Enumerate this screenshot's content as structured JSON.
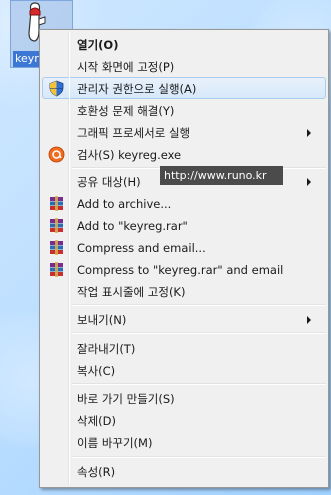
{
  "desktop": {
    "icon_label": "keyre",
    "icon_name": "keyreg-exe-icon"
  },
  "menu": {
    "items": [
      {
        "label": "열기(O)",
        "bold": true
      },
      {
        "label": "시작 화면에 고정(P)"
      },
      {
        "label": "관리자 권한으로 실행(A)",
        "icon": "shield-icon",
        "highlighted": true
      },
      {
        "label": "호환성 문제 해결(Y)"
      },
      {
        "label": "그래픽 프로세서로 실행",
        "submenu": true
      },
      {
        "label": "검사(S) keyreg.exe",
        "icon": "antivirus-icon"
      },
      {
        "label": "공유 대상(H)",
        "submenu": true
      },
      {
        "label": "Add to archive...",
        "icon": "winrar-icon"
      },
      {
        "label": "Add to \"keyreg.rar\"",
        "icon": "winrar-icon"
      },
      {
        "label": "Compress and email...",
        "icon": "winrar-icon"
      },
      {
        "label": "Compress to \"keyreg.rar\" and email",
        "icon": "winrar-icon"
      },
      {
        "label": "작업 표시줄에 고정(K)"
      },
      {
        "label": "보내기(N)",
        "submenu": true
      },
      {
        "label": "잘라내기(T)"
      },
      {
        "label": "복사(C)"
      },
      {
        "label": "바로 가기 만들기(S)"
      },
      {
        "label": "삭제(D)"
      },
      {
        "label": "이름 바꾸기(M)"
      },
      {
        "label": "속성(R)"
      }
    ]
  },
  "tooltip": {
    "text": "http://www.runo.kr"
  },
  "colors": {
    "menu_bg": "#f0f0f0",
    "highlight_border": "#a8cdee",
    "selection_blue": "#3d77d6",
    "tooltip_bg": "#4b4b4b"
  }
}
